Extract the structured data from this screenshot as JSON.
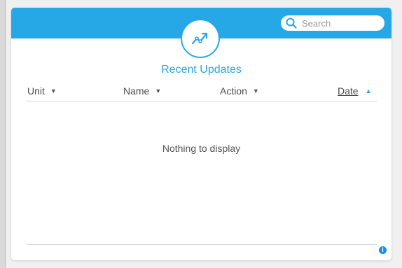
{
  "search": {
    "placeholder": "Search",
    "value": ""
  },
  "panel": {
    "title": "Recent Updates",
    "badge_icon": "trending-up-icon",
    "accent_color": "#26a7e6"
  },
  "columns": [
    {
      "label": "Unit",
      "sort": "none"
    },
    {
      "label": "Name",
      "sort": "none"
    },
    {
      "label": "Action",
      "sort": "none"
    },
    {
      "label": "Date",
      "sort": "ascending"
    }
  ],
  "empty_message": "Nothing to display",
  "info_icon": {
    "glyph": "i"
  }
}
